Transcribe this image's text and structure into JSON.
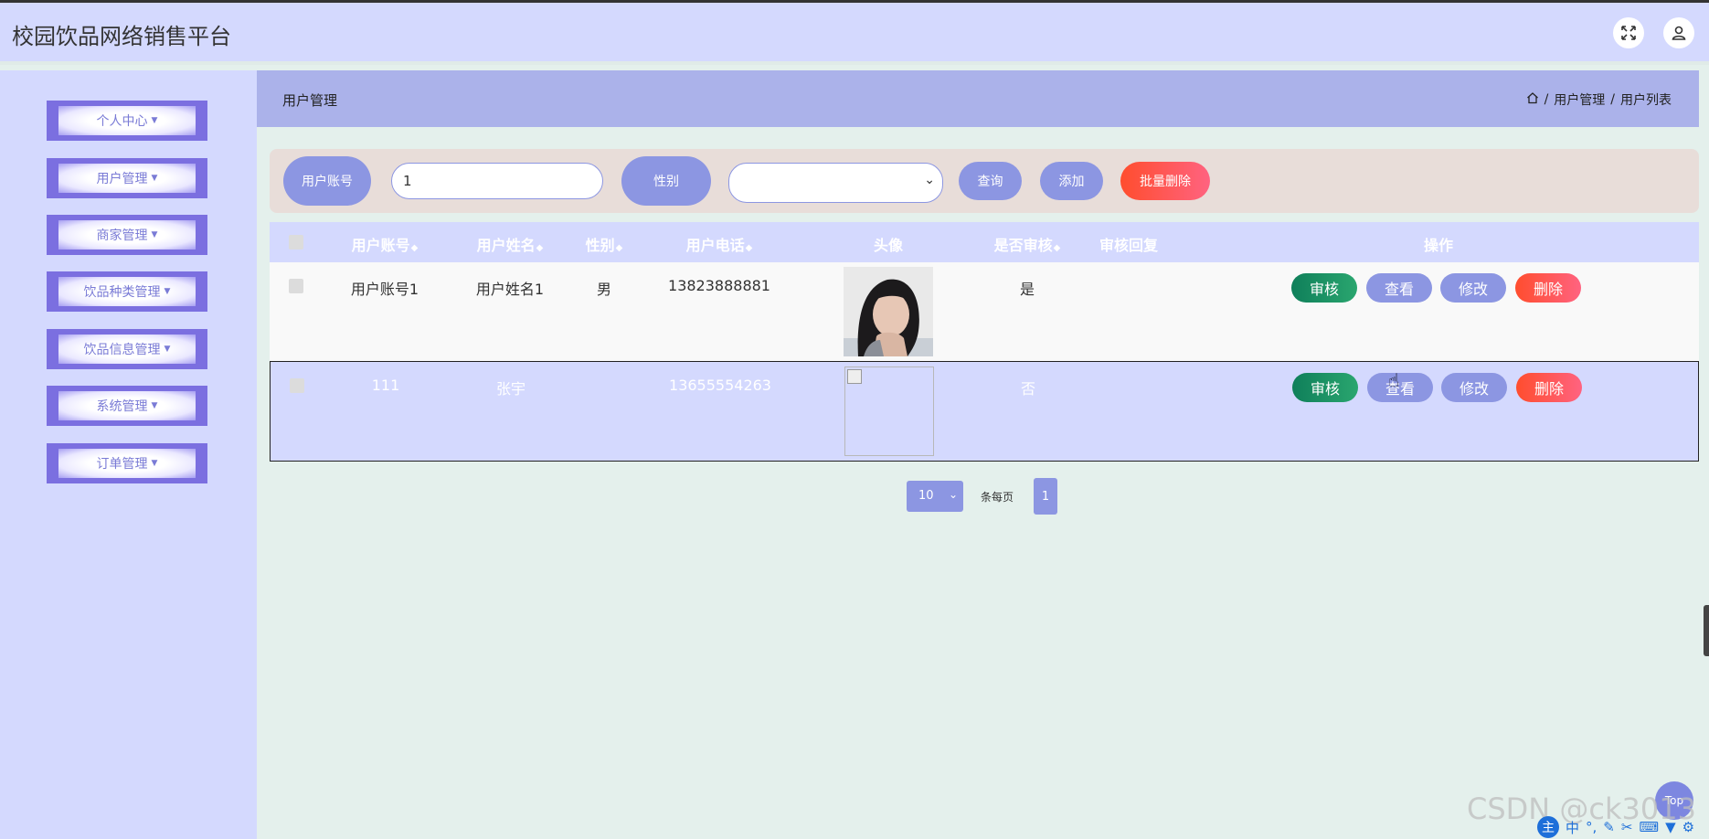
{
  "header": {
    "title": "校园饮品网络销售平台"
  },
  "sidebar": {
    "items": [
      {
        "label": "个人中心"
      },
      {
        "label": "用户管理"
      },
      {
        "label": "商家管理"
      },
      {
        "label": "饮品种类管理"
      },
      {
        "label": "饮品信息管理"
      },
      {
        "label": "系统管理"
      },
      {
        "label": "订单管理"
      }
    ]
  },
  "breadcrumb": {
    "title": "用户管理",
    "path": [
      "用户管理",
      "用户列表"
    ],
    "separator": "/"
  },
  "search": {
    "account_label": "用户账号",
    "account_value": "1",
    "gender_label": "性别",
    "gender_value": "",
    "query_btn": "查询",
    "add_btn": "添加",
    "batch_delete_btn": "批量删除"
  },
  "table": {
    "columns": [
      "用户账号",
      "用户姓名",
      "性别",
      "用户电话",
      "头像",
      "是否审核",
      "审核回复",
      "操作"
    ],
    "sortable": [
      "用户账号",
      "用户姓名",
      "性别",
      "用户电话",
      "是否审核"
    ],
    "rows": [
      {
        "account": "用户账号1",
        "name": "用户姓名1",
        "gender": "男",
        "phone": "13823888881",
        "avatar": "photo",
        "audited": "是",
        "reply": ""
      },
      {
        "account": "111",
        "name": "张宇",
        "gender": "",
        "phone": "13655554263",
        "avatar": "broken-image",
        "audited": "否",
        "reply": ""
      }
    ],
    "actions": [
      "审核",
      "查看",
      "修改",
      "删除"
    ]
  },
  "pagination": {
    "page_size": "10",
    "page_size_label": "条每页",
    "current_page": "1"
  },
  "widgets": {
    "top_button": "Top",
    "watermark": "CSDN @ck3013",
    "ime_main": "主",
    "ime_lang": "中"
  },
  "colors": {
    "primary": "#8c96e2",
    "danger": "#ff4d2e",
    "success": "#0f7f5a",
    "header_bg": "#d4d9fe",
    "crumb_bg": "#abb2ea",
    "menu_border": "#7b6fe0"
  }
}
